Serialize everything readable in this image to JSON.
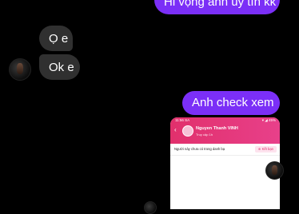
{
  "messages": [
    {
      "id": "msg1",
      "direction": "outgoing",
      "text": "Hi vọng anh uy tín kk"
    },
    {
      "id": "msg2",
      "direction": "incoming",
      "text": "Ọ e"
    },
    {
      "id": "msg3",
      "direction": "incoming",
      "text": "Ok e"
    },
    {
      "id": "msg4",
      "direction": "outgoing",
      "text": "Anh check xem"
    }
  ],
  "shared_screenshot": {
    "status_time": "11:56 SA",
    "status_icons": "▾ ◢ 45%",
    "contact_name": "Nguyen Thanh VINH",
    "contact_status": "Truy cập 1h",
    "stranger_notice": "Người này chưa có trong danh bạ",
    "add_friend_label": "Kết bạn"
  },
  "colors": {
    "outgoing_bubble": "#7b2ff7",
    "incoming_bubble": "#303030",
    "background": "#000000",
    "screenshot_header": "#e1306c"
  }
}
